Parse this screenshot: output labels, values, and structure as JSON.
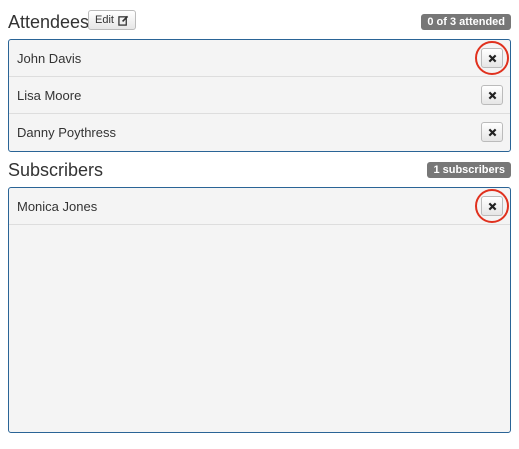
{
  "attendees": {
    "title": "Attendees",
    "edit_label": "Edit",
    "badge": "0 of 3 attended",
    "items": [
      {
        "name": "John Davis"
      },
      {
        "name": "Lisa Moore"
      },
      {
        "name": "Danny Poythress"
      }
    ]
  },
  "subscribers": {
    "title": "Subscribers",
    "badge": "1 subscribers",
    "items": [
      {
        "name": "Monica Jones"
      }
    ]
  },
  "colors": {
    "panel_border": "#2a6496",
    "badge_bg": "#777777",
    "highlight_ring": "#e0311e"
  },
  "icons": {
    "edit": "pencil-square-icon",
    "remove": "times-icon"
  }
}
